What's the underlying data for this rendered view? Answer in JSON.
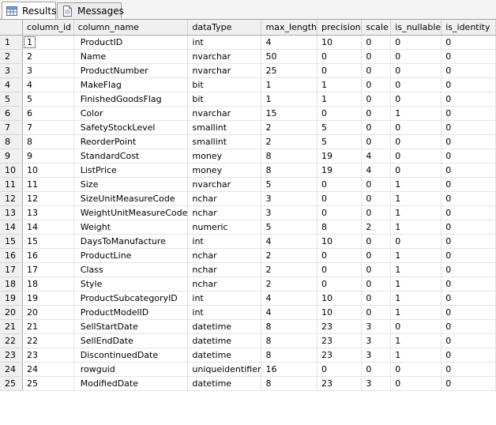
{
  "tabs": [
    {
      "label": "Results",
      "icon": "grid-icon",
      "active": true
    },
    {
      "label": "Messages",
      "icon": "messages-icon",
      "active": false
    }
  ],
  "grid": {
    "columns": [
      "column_id",
      "column_name",
      "dataType",
      "max_length",
      "precision",
      "scale",
      "is_nullable",
      "is_identity"
    ],
    "rows": [
      [
        "1",
        "1",
        "ProductID",
        "int",
        "4",
        "10",
        "0",
        "0",
        "0"
      ],
      [
        "2",
        "2",
        "Name",
        "nvarchar",
        "50",
        "0",
        "0",
        "0",
        "0"
      ],
      [
        "3",
        "3",
        "ProductNumber",
        "nvarchar",
        "25",
        "0",
        "0",
        "0",
        "0"
      ],
      [
        "4",
        "4",
        "MakeFlag",
        "bit",
        "1",
        "1",
        "0",
        "0",
        "0"
      ],
      [
        "5",
        "5",
        "FinishedGoodsFlag",
        "bit",
        "1",
        "1",
        "0",
        "0",
        "0"
      ],
      [
        "6",
        "6",
        "Color",
        "nvarchar",
        "15",
        "0",
        "0",
        "1",
        "0"
      ],
      [
        "7",
        "7",
        "SafetyStockLevel",
        "smallint",
        "2",
        "5",
        "0",
        "0",
        "0"
      ],
      [
        "8",
        "8",
        "ReorderPoint",
        "smallint",
        "2",
        "5",
        "0",
        "0",
        "0"
      ],
      [
        "9",
        "9",
        "StandardCost",
        "money",
        "8",
        "19",
        "4",
        "0",
        "0"
      ],
      [
        "10",
        "10",
        "ListPrice",
        "money",
        "8",
        "19",
        "4",
        "0",
        "0"
      ],
      [
        "11",
        "11",
        "Size",
        "nvarchar",
        "5",
        "0",
        "0",
        "1",
        "0"
      ],
      [
        "12",
        "12",
        "SizeUnitMeasureCode",
        "nchar",
        "3",
        "0",
        "0",
        "1",
        "0"
      ],
      [
        "13",
        "13",
        "WeightUnitMeasureCode",
        "nchar",
        "3",
        "0",
        "0",
        "1",
        "0"
      ],
      [
        "14",
        "14",
        "Weight",
        "numeric",
        "5",
        "8",
        "2",
        "1",
        "0"
      ],
      [
        "15",
        "15",
        "DaysToManufacture",
        "int",
        "4",
        "10",
        "0",
        "0",
        "0"
      ],
      [
        "16",
        "16",
        "ProductLine",
        "nchar",
        "2",
        "0",
        "0",
        "1",
        "0"
      ],
      [
        "17",
        "17",
        "Class",
        "nchar",
        "2",
        "0",
        "0",
        "1",
        "0"
      ],
      [
        "18",
        "18",
        "Style",
        "nchar",
        "2",
        "0",
        "0",
        "1",
        "0"
      ],
      [
        "19",
        "19",
        "ProductSubcategoryID",
        "int",
        "4",
        "10",
        "0",
        "1",
        "0"
      ],
      [
        "20",
        "20",
        "ProductModelID",
        "int",
        "4",
        "10",
        "0",
        "1",
        "0"
      ],
      [
        "21",
        "21",
        "SellStartDate",
        "datetime",
        "8",
        "23",
        "3",
        "0",
        "0"
      ],
      [
        "22",
        "22",
        "SellEndDate",
        "datetime",
        "8",
        "23",
        "3",
        "1",
        "0"
      ],
      [
        "23",
        "23",
        "DiscontinuedDate",
        "datetime",
        "8",
        "23",
        "3",
        "1",
        "0"
      ],
      [
        "24",
        "24",
        "rowguid",
        "uniqueidentifier",
        "16",
        "0",
        "0",
        "0",
        "0"
      ],
      [
        "25",
        "25",
        "ModifiedDate",
        "datetime",
        "8",
        "23",
        "3",
        "0",
        "0"
      ]
    ]
  }
}
